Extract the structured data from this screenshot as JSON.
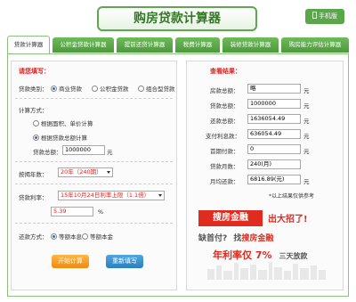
{
  "header": {
    "title": "购房贷款计算器",
    "phone_button": "手机版"
  },
  "tabs": [
    {
      "label": "贷款计算器",
      "active": true
    },
    {
      "label": "公积金贷款计算器",
      "active": false
    },
    {
      "label": "提前还贷计算器",
      "active": false
    },
    {
      "label": "税费计算器",
      "active": false
    },
    {
      "label": "装修贷款计算器",
      "active": false
    },
    {
      "label": "购房能力评估计算器",
      "active": false
    }
  ],
  "form": {
    "heading": "请您填写：",
    "loan_type_label": "贷款类别：",
    "loan_types": [
      "商业贷款",
      "公积金贷款",
      "组合型贷款"
    ],
    "calc_method_label": "计算方式：",
    "calc_methods": [
      "根据面积、单价计算",
      "根据贷款总额计算"
    ],
    "total_label": "贷款总额：",
    "total_value": "1000000",
    "total_unit": "元",
    "years_label": "按揭年数：",
    "years_value": "20年（240期）",
    "rate_label": "贷款利率：",
    "rate_value": "15年10月24日利率上限（1.1倍）",
    "rate_input": "5.39",
    "rate_unit": "%",
    "repay_label": "还款方式：",
    "repay_methods": [
      "等额本息",
      "等额本金"
    ],
    "calc_button": "开始计算",
    "reset_button": "重新填写"
  },
  "result": {
    "heading": "查看结果：",
    "rows": [
      {
        "label": "房款总额：",
        "value": "略",
        "unit": "元"
      },
      {
        "label": "贷款总额：",
        "value": "1000000",
        "unit": "元"
      },
      {
        "label": "还款总额：",
        "value": "1636054.49",
        "unit": "元"
      },
      {
        "label": "支付利息款：",
        "value": "636054.49",
        "unit": "元"
      },
      {
        "label": "首期付款：",
        "value": "0",
        "unit": "元"
      },
      {
        "label": "贷款月数：",
        "value": "240(月)",
        "unit": ""
      },
      {
        "label": "月均还款：",
        "value": "6816.89(元)",
        "unit": "元"
      }
    ],
    "note": "*以上结果仅供参考"
  },
  "ad": {
    "brand": "搜房金融",
    "slogan": "出大招了!",
    "line2_a": "缺首付?",
    "line2_b": "找",
    "line2_c": "搜房金融",
    "rate_text": "年利率仅 7%",
    "fast_text": "三天放款"
  },
  "colors": {
    "accent_green": "#5aa64a",
    "tab_green": "#4c9a3c",
    "alert_red": "#e02020",
    "orange_button": "#f08a10",
    "blue_button": "#2a7fc0"
  }
}
